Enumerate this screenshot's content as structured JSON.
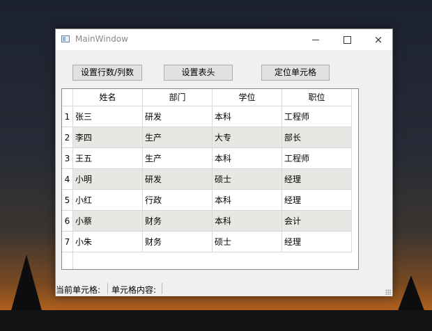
{
  "window": {
    "title": "MainWindow",
    "controls": {
      "minimize": "minimize",
      "maximize": "maximize",
      "close": "×"
    }
  },
  "toolbar": {
    "set_rowcol_label": "设置行数/列数",
    "set_header_label": "设置表头",
    "locate_cell_label": "定位单元格"
  },
  "table": {
    "columns": [
      "姓名",
      "部门",
      "学位",
      "职位"
    ],
    "row_numbers": [
      "1",
      "2",
      "3",
      "4",
      "5",
      "6",
      "7"
    ],
    "rows": [
      [
        "张三",
        "研发",
        "本科",
        "工程师"
      ],
      [
        "李四",
        "生产",
        "大专",
        "部长"
      ],
      [
        "王五",
        "生产",
        "本科",
        "工程师"
      ],
      [
        "小明",
        "研发",
        "硕士",
        "经理"
      ],
      [
        "小红",
        "行政",
        "本科",
        "经理"
      ],
      [
        "小蔡",
        "财务",
        "本科",
        "会计"
      ],
      [
        "小朱",
        "财务",
        "硕士",
        "经理"
      ]
    ],
    "alternate_row_color": "#e9e7e3"
  },
  "statusbar": {
    "current_cell_label": "当前单元格:",
    "cell_content_label": "单元格内容:"
  }
}
